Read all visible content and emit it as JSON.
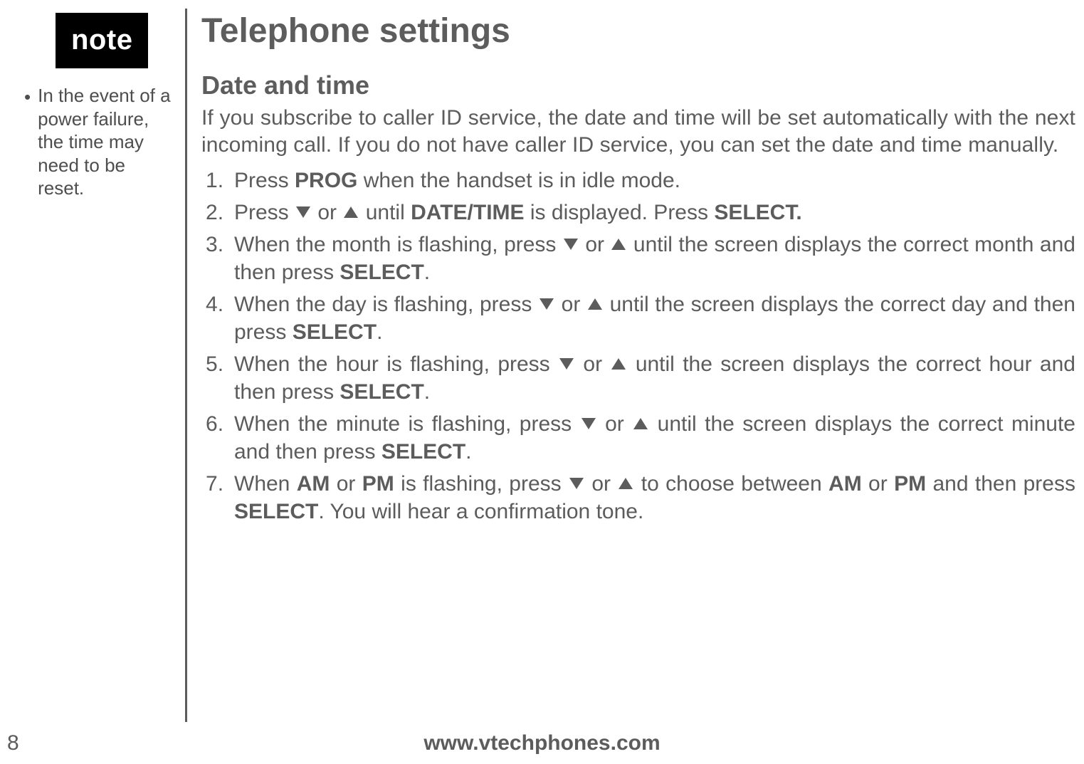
{
  "sidebar": {
    "tag": "note",
    "bullet": "•",
    "note_text": "In the event of a power failure, the time may need to be reset."
  },
  "main": {
    "title": "Telephone settings",
    "subtitle": "Date and time",
    "intro": "If you subscribe to caller ID service, the date and time will be set automatically with the next incoming call. If you do not have caller ID service, you can set the date and time manually.",
    "kw": {
      "prog": "PROG",
      "datetime": "DATE/TIME",
      "select": "SELECT",
      "select_dot": "SELECT.",
      "am": "AM",
      "pm": "PM"
    },
    "steps": {
      "s1a": "Press ",
      "s1b": " when the handset is in idle mode.",
      "s2a": "Press ",
      "s2b": " or ",
      "s2c": " until ",
      "s2d": " is displayed. Press ",
      "s3a": "When the month is flashing, press ",
      "s3b": " or ",
      "s3c": " until the screen displays the correct month and then press ",
      "s4a": "When the day is flashing, press ",
      "s4b": " or ",
      "s4c": " until the screen displays the correct day and then press ",
      "s5a": "When the hour is flashing, press ",
      "s5b": " or ",
      "s5c": " until the screen displays the correct hour and then press ",
      "s6a": "When the minute is flashing, press ",
      "s6b": " or ",
      "s6c": " until the screen displays the correct minute and then press ",
      "s7a": "When ",
      "s7b": " or ",
      "s7c": " is flashing, press ",
      "s7d": " or ",
      "s7e": " to choose between ",
      "s7f": " or ",
      "s7g": " and then press ",
      "s7h": ". You will hear a confirmation tone."
    }
  },
  "footer": {
    "page": "8",
    "url": "www.vtechphones.com"
  }
}
